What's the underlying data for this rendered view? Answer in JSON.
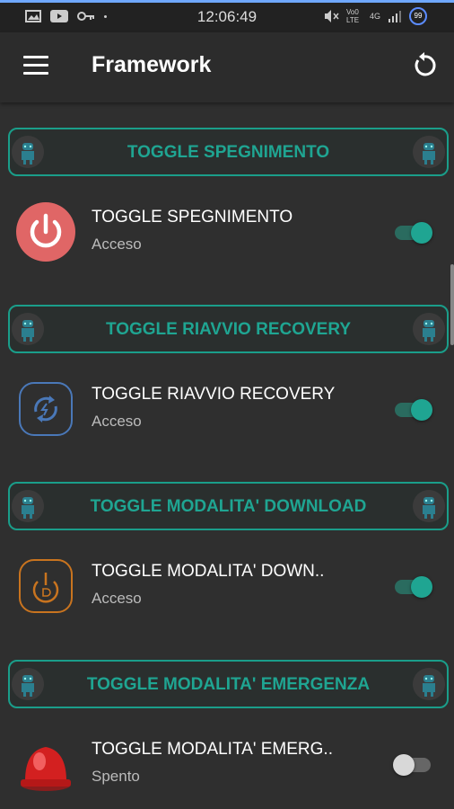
{
  "status_bar": {
    "time": "12:06:49",
    "network": "4G",
    "volte": "Vo0 LTE",
    "battery": "99"
  },
  "app_bar": {
    "title": "Framework"
  },
  "sections": [
    {
      "header": "TOGGLE SPEGNIMENTO",
      "title": "TOGGLE SPEGNIMENTO",
      "status": "Acceso",
      "enabled": true,
      "icon": "power-icon"
    },
    {
      "header": "TOGGLE RIAVVIO RECOVERY",
      "title": "TOGGLE RIAVVIO RECOVERY",
      "status": "Acceso",
      "enabled": true,
      "icon": "recovery-icon"
    },
    {
      "header": "TOGGLE MODALITA' DOWNLOAD",
      "title": "TOGGLE MODALITA' DOWN..",
      "status": "Acceso",
      "enabled": true,
      "icon": "download-mode-icon"
    },
    {
      "header": "TOGGLE MODALITA' EMERGENZA",
      "title": "TOGGLE MODALITA' EMERG..",
      "status": "Spento",
      "enabled": false,
      "icon": "emergency-siren-icon"
    }
  ],
  "colors": {
    "accent": "#1fa592",
    "background": "#2f2f2f",
    "power_red": "#e06666"
  }
}
